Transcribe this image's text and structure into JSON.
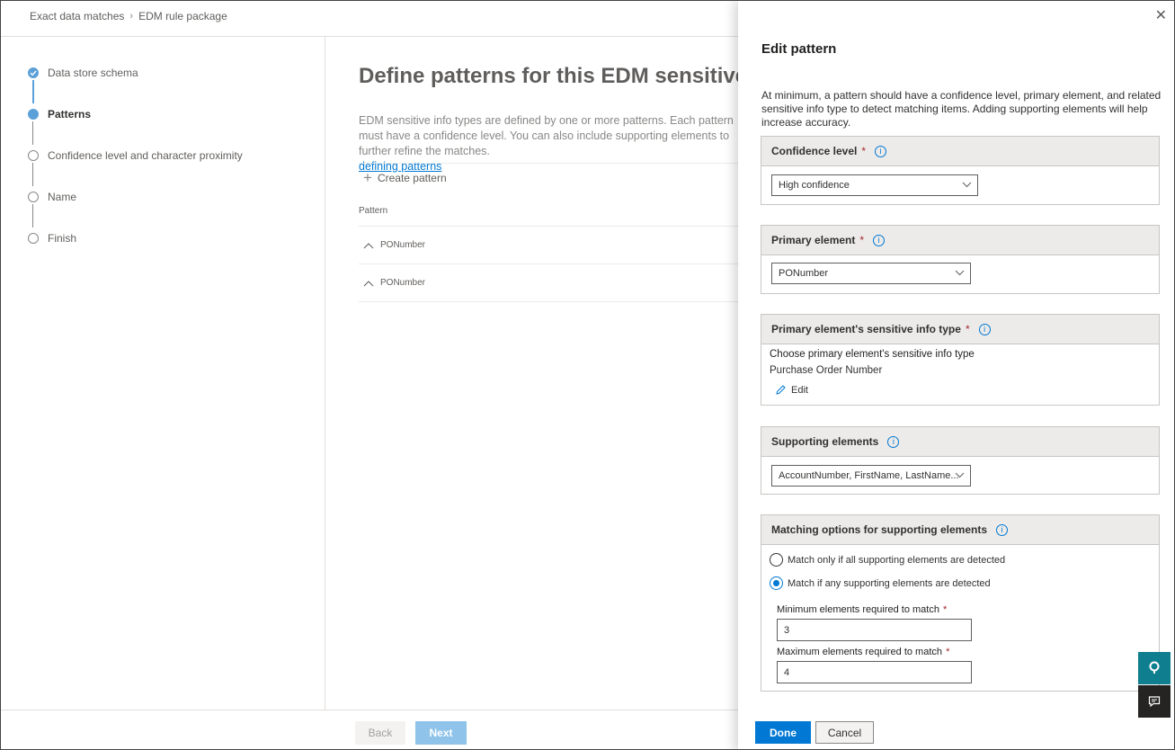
{
  "breadcrumb": {
    "item1": "Exact data matches",
    "item2": "EDM rule package"
  },
  "steps": [
    {
      "label": "Data store schema",
      "state": "done"
    },
    {
      "label": "Patterns",
      "state": "current"
    },
    {
      "label": "Confidence level and character proximity",
      "state": "todo"
    },
    {
      "label": "Name",
      "state": "todo"
    },
    {
      "label": "Finish",
      "state": "todo"
    }
  ],
  "main": {
    "title": "Define patterns for this EDM sensitive info type",
    "desc_line1": "EDM sensitive info types are defined by one or more patterns. Each pattern must have a",
    "desc_line2": "confidence level. You can also include supporting elements to further refine the matches.",
    "link": "defining patterns",
    "create_label": "Create pattern",
    "column_header": "Pattern",
    "rows": [
      "PONumber",
      "PONumber"
    ]
  },
  "footer": {
    "back": "Back",
    "next": "Next"
  },
  "panel": {
    "title": "Edit pattern",
    "desc": "At minimum, a pattern should have a confidence level, primary element, and related sensitive info type to detect matching items. Adding supporting elements will help increase accuracy.",
    "confidence": {
      "label": "Confidence level",
      "value": "High confidence"
    },
    "primary": {
      "label": "Primary element",
      "value": "PONumber"
    },
    "sit": {
      "label": "Primary element's sensitive info type",
      "choose": "Choose primary element's sensitive info type",
      "value": "Purchase Order Number",
      "edit": "Edit"
    },
    "supporting": {
      "label": "Supporting elements",
      "value": "AccountNumber, FirstName, LastName..."
    },
    "matching": {
      "label": "Matching options for supporting elements",
      "option_all": "Match only if all supporting elements are detected",
      "option_any": "Match if any supporting elements are detected",
      "selected": "any",
      "min_label": "Minimum elements required to match",
      "min_value": "3",
      "max_label": "Maximum elements required to match",
      "max_value": "4"
    },
    "done": "Done",
    "cancel": "Cancel"
  },
  "required_mark": "*",
  "colors": {
    "accent": "#0078d4",
    "step": "#5ba0d8",
    "next_disabled": "#8fc3ea"
  }
}
